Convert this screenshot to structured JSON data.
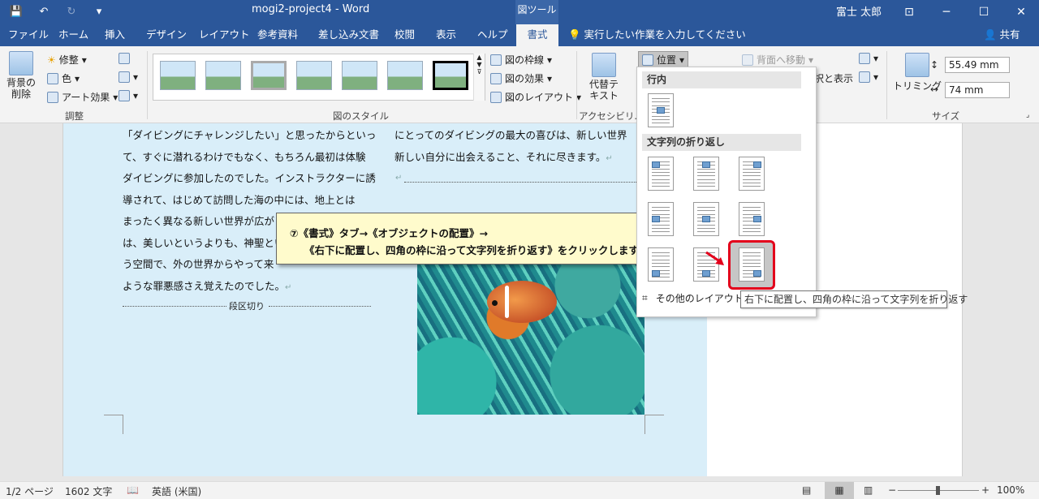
{
  "window": {
    "title": "mogi2-project4 - Word",
    "tool_context": "図ツール",
    "user": "富士 太郎",
    "minimize": "─",
    "maximize": "☐",
    "close": "✕"
  },
  "tabs": [
    {
      "label": "ファイル"
    },
    {
      "label": "ホーム"
    },
    {
      "label": "挿入"
    },
    {
      "label": "デザイン"
    },
    {
      "label": "レイアウト"
    },
    {
      "label": "参考資料"
    },
    {
      "label": "差し込み文書"
    },
    {
      "label": "校閲"
    },
    {
      "label": "表示"
    },
    {
      "label": "ヘルプ"
    },
    {
      "label": "書式"
    }
  ],
  "tell_me": "実行したい作業を入力してください",
  "share": "共有",
  "ribbon": {
    "remove_bg": "背景の\n削除",
    "corrections": "修整",
    "color": "色",
    "artistic": "アート効果",
    "group_adjust": "調整",
    "group_styles": "図のスタイル",
    "border": "図の枠線",
    "effects": "図の効果",
    "layout": "図のレイアウト",
    "alt_text": "代替テ\nキスト",
    "group_access": "アクセシビリ...",
    "position": "位置",
    "send_back": "背面へ移動",
    "selection": "択と表示",
    "crop": "トリミング",
    "height": "55.49 mm",
    "width": "74 mm",
    "group_size": "サイズ"
  },
  "document": {
    "left_lines": [
      "「ダイビングにチャレンジしたい」と思ったからといっ",
      "て、すぐに潜れるわけでもなく、もちろん最初は体験",
      "ダイビングに参加したのでした。インストラクターに誘",
      "導されて、はじめて訪問した海の中には、地上とは",
      "まったく異なる新しい世界が広が",
      "は、美しいというよりも、神聖とい",
      "う空間で、外の世界からやって来",
      "ような罪悪感さえ覚えたのでした。"
    ],
    "section_break": "段区切り",
    "right_lines": [
      "にとってのダイビングの最大の喜びは、新しい世界",
      "新しい自分に出会えること、それに尽きます。"
    ]
  },
  "callout": {
    "line1": "⑦《書式》タブ→《オブジェクトの配置》→",
    "line2": "《右下に配置し、四角の枠に沿って文字列を折り返す》をクリックします。"
  },
  "dropdown": {
    "header_inline": "行内",
    "header_wrap": "文字列の折り返し",
    "more": "その他のレイアウト オ"
  },
  "tooltip": "右下に配置し、四角の枠に沿って文字列を折り返す",
  "status": {
    "page": "1/2 ページ",
    "words": "1602 文字",
    "language": "英語 (米国)",
    "zoom": "100%",
    "zoom_minus": "−",
    "zoom_plus": "+"
  },
  "colors": {
    "word_blue": "#2b579a",
    "highlight_red": "#e3001b",
    "callout_bg": "#fffbcc"
  }
}
